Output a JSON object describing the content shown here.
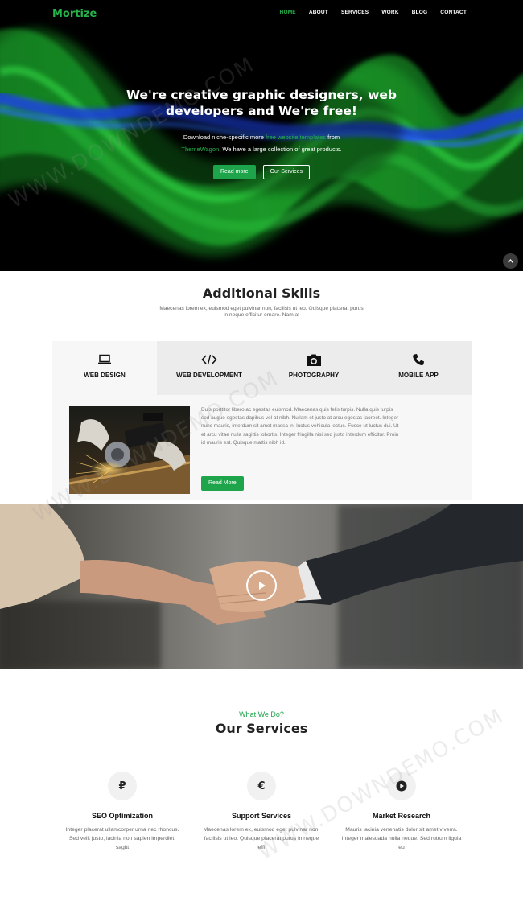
{
  "brand": {
    "name": "Mortize",
    "accent": "#25b34b"
  },
  "nav": {
    "items": [
      {
        "label": "HOME",
        "active": true
      },
      {
        "label": "ABOUT",
        "active": false
      },
      {
        "label": "SERVICES",
        "active": false
      },
      {
        "label": "WORK",
        "active": false
      },
      {
        "label": "BLOG",
        "active": false
      },
      {
        "label": "CONTACT",
        "active": false
      }
    ]
  },
  "hero": {
    "title_line1": "We're creative graphic designers, web",
    "title_line2": "developers and We're free!",
    "sub_pre": "Download niche-specific more ",
    "sub_link1": "free website templates",
    "sub_mid": " from",
    "sub_link2": "ThemeWagon",
    "sub_post": ". We have a large collection of great products.",
    "btn_primary": "Read more",
    "btn_secondary": "Our Services",
    "scroll_icon": "chevron-up-icon"
  },
  "skills": {
    "title": "Additional Skills",
    "desc": "Maecenas lorem ex, euismod eget pulvinar non, facilisis ut leo. Quisque placerat purus in neque efficitur ornare. Nam at",
    "tabs": [
      {
        "label": "WEB DESIGN",
        "icon": "laptop-icon",
        "active": true
      },
      {
        "label": "WEB DEVELOPMENT",
        "icon": "code-icon",
        "active": false
      },
      {
        "label": "PHOTOGRAPHY",
        "icon": "camera-icon",
        "active": false
      },
      {
        "label": "MOBILE APP",
        "icon": "phone-icon",
        "active": false
      }
    ],
    "panel_text": "Duis porttitor libero ac egestas euismod. Maecenas quis felis turpis. Nulla quis turpis sed augue egestas dapibus vel at nibh. Nullam et justo at arcu egestas laoreet. Integer nunc mauris, interdum sit amet massa in, luctus vehicula lectus. Fusce ut luctus dui. Ut et arcu vitae nulla sagittis lobortis. Integer fringilla nisi sed justo interdum efficitur. Proin id mauris est. Quisque mattis nibh id.",
    "panel_button": "Read More"
  },
  "video": {
    "play_icon": "play-icon"
  },
  "services": {
    "kicker": "What We Do?",
    "title": "Our Services",
    "items": [
      {
        "icon": "ruble-icon",
        "symbol": "₽",
        "name": "SEO Optimization",
        "text": "Integer placerat ullamcorper urna nec rhoncus. Sed velit justo, lacinia non sapien imperdiet, sagitt"
      },
      {
        "icon": "euro-icon",
        "symbol": "€",
        "name": "Support Services",
        "text": "Maecenas lorem ex, euismod eget pulvinar non, facilisis ut leo. Quisque placerat purus in neque effi"
      },
      {
        "icon": "play-circle-icon",
        "symbol": "",
        "name": "Market Research",
        "text": "Mauris lacinia venenatis dolor sit amet viverra. Integer malesuada nulla neque. Sed rutrum ligula eu"
      }
    ]
  },
  "watermark": "WWW.DOWNDEMO.COM"
}
